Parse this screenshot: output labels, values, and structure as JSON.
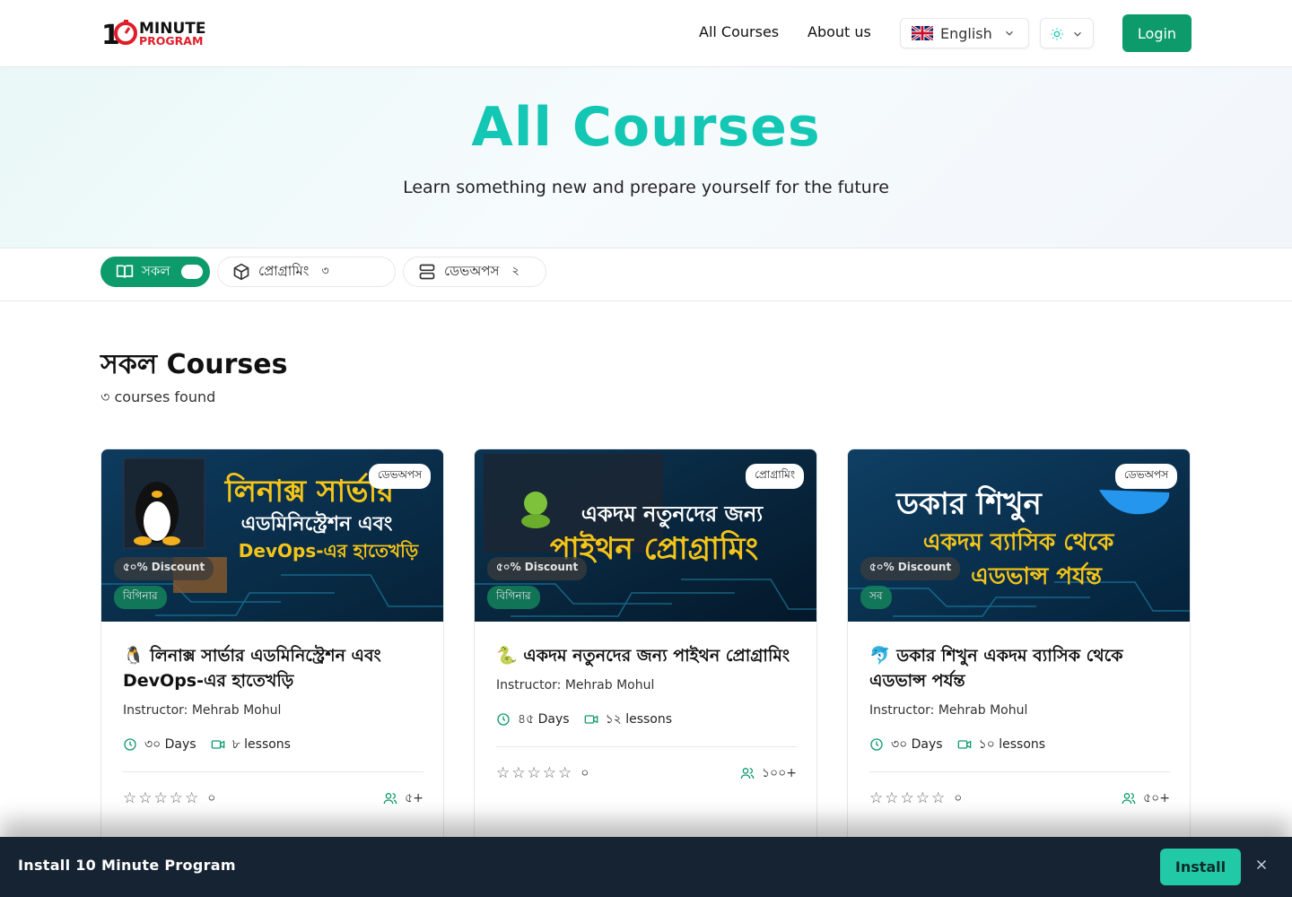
{
  "header": {
    "logo_text_top": "MINUTE",
    "logo_text_bottom": "PROGRAM",
    "nav": [
      "All Courses",
      "About us"
    ],
    "language": "English",
    "login_label": "Login"
  },
  "hero": {
    "title": "All Courses",
    "subtitle": "Learn something new and prepare yourself for the future"
  },
  "filters": [
    {
      "label": "সকল",
      "count": "",
      "active": true
    },
    {
      "label": "প্রোগ্রামিং",
      "count": "৩",
      "active": false
    },
    {
      "label": "ডেভঅপস",
      "count": "২",
      "active": false
    }
  ],
  "section": {
    "title": "সকল Courses",
    "count_text": "৩ courses found"
  },
  "courses": [
    {
      "badge": "ডেভঅপস",
      "discount": "৫০% Discount",
      "level": "বিগিনার",
      "banner_line1": "লিনাক্স সার্ভার",
      "banner_line2": "এডমিনিস্ট্রেশন এবং",
      "banner_line3": "DevOps-এর হাতেখড়ি",
      "title": "🐧 লিনাক্স সার্ভার এডমিনিস্ট্রেশন এবং DevOps-এর হাতেখড়ি",
      "instructor": "Instructor: Mehrab Mohul",
      "days": "৩০ Days",
      "lessons": "৮ lessons",
      "rating": "০",
      "enrolled": "৫+"
    },
    {
      "badge": "প্রোগ্রামিং",
      "discount": "৫০% Discount",
      "level": "বিগিনার",
      "banner_line1": "একদম নতুনদের জন্য",
      "banner_line2": "পাইথন প্রোগ্রামিং",
      "banner_line3": "",
      "title": "🐍 একদম নতুনদের জন্য পাইথন প্রোগ্রামিং",
      "instructor": "Instructor: Mehrab Mohul",
      "days": "৪৫ Days",
      "lessons": "১২ lessons",
      "rating": "০",
      "enrolled": "১০০+"
    },
    {
      "badge": "ডেভঅপস",
      "discount": "৫০% Discount",
      "level": "সব",
      "banner_line1": "ডকার শিখুন",
      "banner_line2": "একদম ব্যাসিক থেকে",
      "banner_line3": "এডভান্স পর্যন্ত",
      "title": "🐬 ডকার শিখুন একদম ব্যাসিক থেকে এডভান্স পর্যন্ত",
      "instructor": "Instructor: Mehrab Mohul",
      "days": "৩০ Days",
      "lessons": "১০ lessons",
      "rating": "০",
      "enrolled": "৫০+"
    }
  ],
  "install_banner": {
    "text": "Install 10 Minute Program",
    "button": "Install"
  },
  "colors": {
    "brand": "#0e9b6c",
    "accent": "#14c7b4",
    "logo_red": "#e11d2a",
    "banner_yellow": "#f5c518"
  }
}
